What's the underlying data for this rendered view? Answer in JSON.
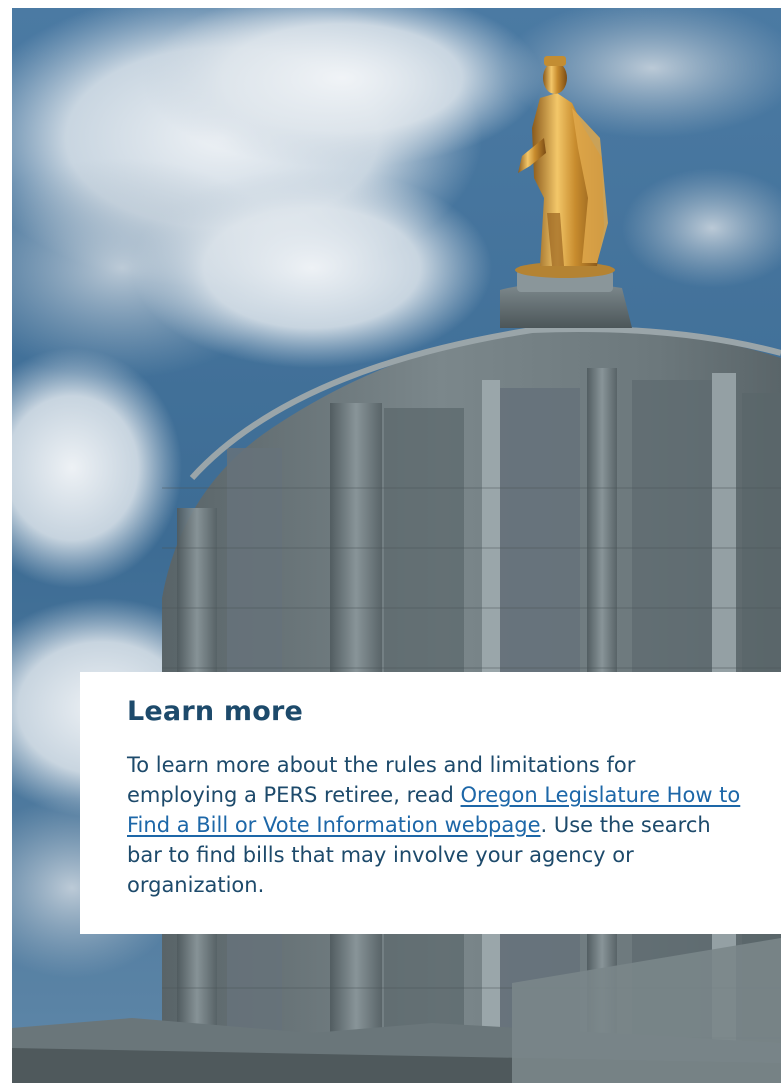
{
  "learn_more": {
    "title": "Learn more",
    "body_start": "To learn more about the rules and limitations for employing a PERS retiree, read ",
    "link_text": "Oregon Legislature How to Find a Bill or Vote Information webpage",
    "body_end": ". Use the search bar to find bills that may involve your agency or organization."
  },
  "colors": {
    "heading": "#1d4a6b",
    "link": "#1d67a8",
    "sky": "#3f6f98",
    "marble": "#6e7c80",
    "statue_gold": "#d9a441"
  },
  "image": {
    "icon": "capitol-dome-image"
  }
}
